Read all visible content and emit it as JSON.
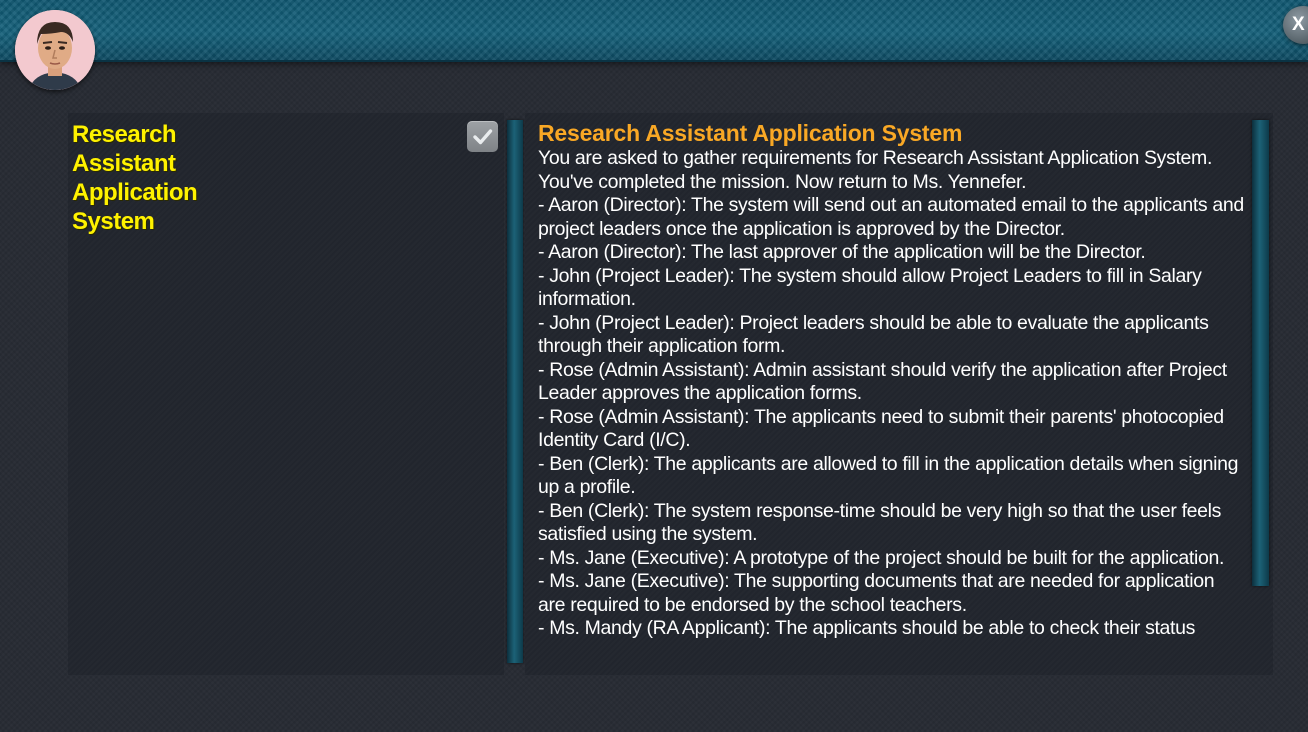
{
  "close_button": {
    "label": "X"
  },
  "mission_list": {
    "items": [
      {
        "title": "Research Assistant Application System",
        "completed": true
      }
    ]
  },
  "mission_detail": {
    "title": "Research Assistant Application System",
    "lines": [
      "You are asked to gather requirements for Research Assistant Application System.",
      "You've completed the mission. Now return to Ms. Yennefer.",
      "- Aaron (Director): The system will send out an automated email to the applicants and project leaders once the application is approved by the Director.",
      "- Aaron (Director): The last approver of the application will be the Director.",
      "- John (Project Leader): The system should allow Project Leaders to fill in Salary information.",
      "- John (Project Leader): Project leaders should be able to evaluate the applicants through their application form.",
      "- Rose (Admin Assistant): Admin assistant should verify the application after Project Leader approves the application forms.",
      "- Rose (Admin Assistant): The applicants need to submit their parents' photocopied Identity Card (I/C).",
      "- Ben (Clerk): The applicants are allowed to fill in the application details when signing up a profile.",
      "- Ben (Clerk): The system response-time should be very high so that the user feels satisfied using the system.",
      "- Ms. Jane (Executive): A prototype of the project should be built for the application.",
      "- Ms. Jane (Executive): The supporting documents that are needed for application are required to be endorsed by the school teachers.",
      "- Ms. Mandy (RA Applicant): The applicants should be able to check their status"
    ]
  },
  "colors": {
    "mission_title": "#fff200",
    "detail_title": "#f9a825",
    "topbar": "#14607a",
    "panel": "#22262e",
    "accent_bar": "#1c6277"
  },
  "icons": {
    "avatar": "player-avatar-icon",
    "check": "checkmark-icon"
  }
}
